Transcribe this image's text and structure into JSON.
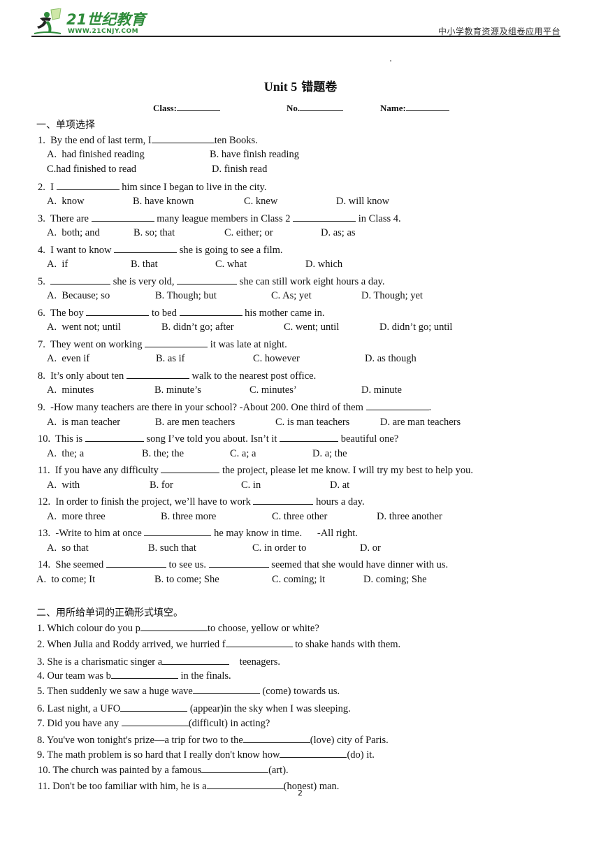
{
  "header": {
    "logo_text": "21世纪教育",
    "logo_url": "WWW.21CNJY.COM",
    "right_text": "中小学教育资源及组卷应用平台",
    "brand_color": "#2e8b3a"
  },
  "title": {
    "en": "Unit 5",
    "cn": "错题卷"
  },
  "info": {
    "class_label": "Class:",
    "no_label": "No.",
    "name_label": "Name:"
  },
  "section1": {
    "title": "一、单项选择",
    "questions": [
      {
        "pre": "1.  By the end of last term, I",
        "blank1": "",
        "mid": "ten Books.",
        "options": [
          "A.  had finished reading",
          "B. have finish reading",
          "C.had finished to read",
          "D. finish read"
        ]
      },
      {
        "pre": "2.  I ",
        "mid": " him since I began to live in the city.",
        "options": [
          "A.  know",
          "B. have known",
          "C. knew",
          "D. will know"
        ]
      },
      {
        "pre": "3.  There are ",
        "mid": " many league members in Class 2 ",
        "post": " in Class 4.",
        "options": [
          "A.  both; and",
          "B. so; that",
          "C. either; or",
          "D. as; as"
        ]
      },
      {
        "pre": "4.  I want to know ",
        "mid": " she is going to see a film.",
        "options": [
          "A.  if",
          "B. that",
          "C. what",
          "D. which"
        ]
      },
      {
        "pre": "5.  ",
        "mid": " she is very old, ",
        "post": " she can still work eight hours a day.",
        "options": [
          "A.  Because; so",
          "B. Though; but",
          "C. As; yet",
          "D. Though; yet"
        ]
      },
      {
        "pre": "6.  The boy ",
        "mid": " to bed ",
        "post": " his mother came in.",
        "options": [
          "A.  went not; until",
          "B. didn’t go; after",
          "C. went; until",
          "D. didn’t go; until"
        ]
      },
      {
        "pre": "7.  They went on working ",
        "mid": " it was late at night.",
        "options": [
          "A.  even if",
          "B. as if",
          "C. however",
          "D. as though"
        ]
      },
      {
        "pre": "8.  It’s only about ten ",
        "mid": " walk to the nearest post office.",
        "options": [
          "A.  minutes",
          "B. minute’s",
          "C. minutes’",
          "D. minute"
        ]
      },
      {
        "pre": "9.  -How many teachers are there in your school? -About 200. One third of them ",
        "mid": ".",
        "options": [
          "A.  is man teacher",
          "B. are men teachers",
          "C. is man teachers",
          "D. are man teachers"
        ]
      },
      {
        "pre": "10.  This is ",
        "mid": " song I’ve told you about. Isn’t it ",
        "post": " beautiful one?",
        "options": [
          "A.  the; a",
          "B. the; the",
          "C. a; a",
          "D. a; the"
        ]
      },
      {
        "pre": "11.  If you have any difficulty ",
        "mid": " the project, please let me know. I will try my best to help you.",
        "options": [
          "A.  with",
          "B. for",
          "C. in",
          "D. at"
        ]
      },
      {
        "pre": "12.  In order to finish the project, we’ll have to work ",
        "mid": " hours a day.",
        "options": [
          "A.  more three",
          "B. three more",
          "C. three other",
          "D. three another"
        ]
      },
      {
        "pre": "13.  -Write to him at once ",
        "mid": " he may know in time.      -All right.",
        "options": [
          "A.  so that",
          "B. such that",
          "C. in order to",
          "D. or"
        ]
      },
      {
        "pre": "14.  She seemed ",
        "mid": " to see us. ",
        "post": " seemed that she would have dinner with us.",
        "options": [
          "A.  to come; It",
          "B. to come; She",
          "C. coming; it",
          "D. coming; She"
        ]
      }
    ]
  },
  "section2": {
    "title": "二、用所给单词的正确形式填空。",
    "items": [
      {
        "pre": "1. Which colour do you p",
        "post": "to choose, yellow or white?"
      },
      {
        "pre": "2. When Julia and Roddy arrived, we hurried f",
        "post": " to shake hands with them."
      },
      {
        "pre": "3. She is a charismatic singer a",
        "post": "    teenagers."
      },
      {
        "pre": "4. Our team was b",
        "post": " in the finals."
      },
      {
        "pre": "5. Then suddenly we saw a huge wave",
        "post": " (come) towards us."
      },
      {
        "pre": "6. Last night, a UFO",
        "post": " (appear)in the sky when I was sleeping."
      },
      {
        "pre": "7. Did you have any ",
        "post": "(difficult) in acting?"
      },
      {
        "pre": "8. You've won tonight's prize—a trip for two to the",
        "post": "(love) city of Paris."
      },
      {
        "pre": "9. The math problem is so hard that I really don't know how",
        "post": "(do) it."
      },
      {
        "pre": "10. The church was painted by a famous",
        "post": "(art)."
      },
      {
        "pre": "11. Don't be too familiar with him, he is a",
        "post": "(honest) man."
      }
    ]
  },
  "footer": {
    "page_number": "2"
  }
}
